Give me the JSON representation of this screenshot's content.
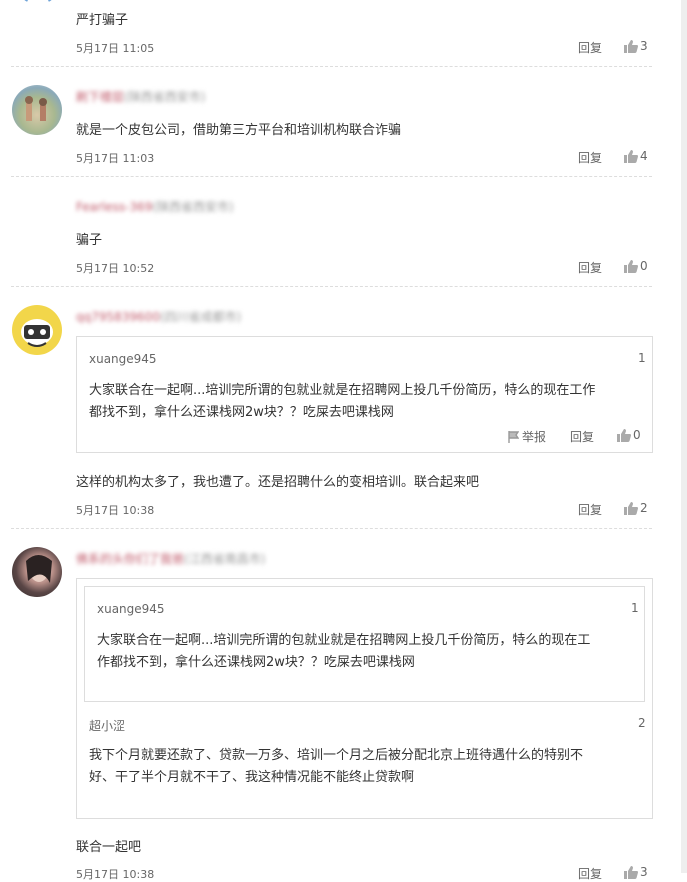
{
  "comments": [
    {
      "text": "严打骗子",
      "time": "5月17日 11:05",
      "reply": "回复",
      "likes": "3"
    },
    {
      "user": "刷下楼层",
      "location": "(陕西省西安市)",
      "text": "就是一个皮包公司，借助第三方平台和培训机构联合诈骗",
      "time": "5月17日 11:03",
      "reply": "回复",
      "likes": "4"
    },
    {
      "user": "Fearless-369",
      "location": "(陕西省西安市)",
      "text": "骗子",
      "time": "5月17日 10:52",
      "reply": "回复",
      "likes": "0"
    },
    {
      "user": "qq795839600",
      "location": "(四川省成都市)",
      "quote": {
        "user": "xuange945",
        "floor": "1",
        "line1": "大家联合在一起啊...培训完所谓的包就业就是在招聘网上投几千份简历，特么的现在工作",
        "line2": "都找不到，拿什么还课栈网2w块？？吃屎去吧课栈网",
        "report": "举报",
        "reply": "回复",
        "likes": "0"
      },
      "text": "这样的机构太多了，我也遭了。还是招聘什么的变相培训。联合起来吧",
      "time": "5月17日 10:38",
      "reply": "回复",
      "likes": "2"
    },
    {
      "user": "佛系的头你们了我爸",
      "location": "(江西省南昌市)",
      "quote_outer": {
        "user": "xuange945",
        "floor": "1",
        "line1": "大家联合在一起啊...培训完所谓的包就业就是在招聘网上投几千份简历，特么的现在工",
        "line2": "作都找不到，拿什么还课栈网2w块？？吃屎去吧课栈网"
      },
      "quote_inner": {
        "user": "超小涩",
        "floor": "2",
        "line1": "我下个月就要还款了、贷款一万多、培训一个月之后被分配北京上班待遇什么的特别不",
        "line2": "好、干了半个月就不干了、我这种情况能不能终止贷款啊"
      },
      "text": "联合一起吧",
      "time": "5月17日 10:38",
      "reply": "回复",
      "likes": "3"
    }
  ],
  "colors": {
    "username_red": "#c05a6a",
    "meta_gray": "#666666",
    "divider": "#dddddd"
  }
}
